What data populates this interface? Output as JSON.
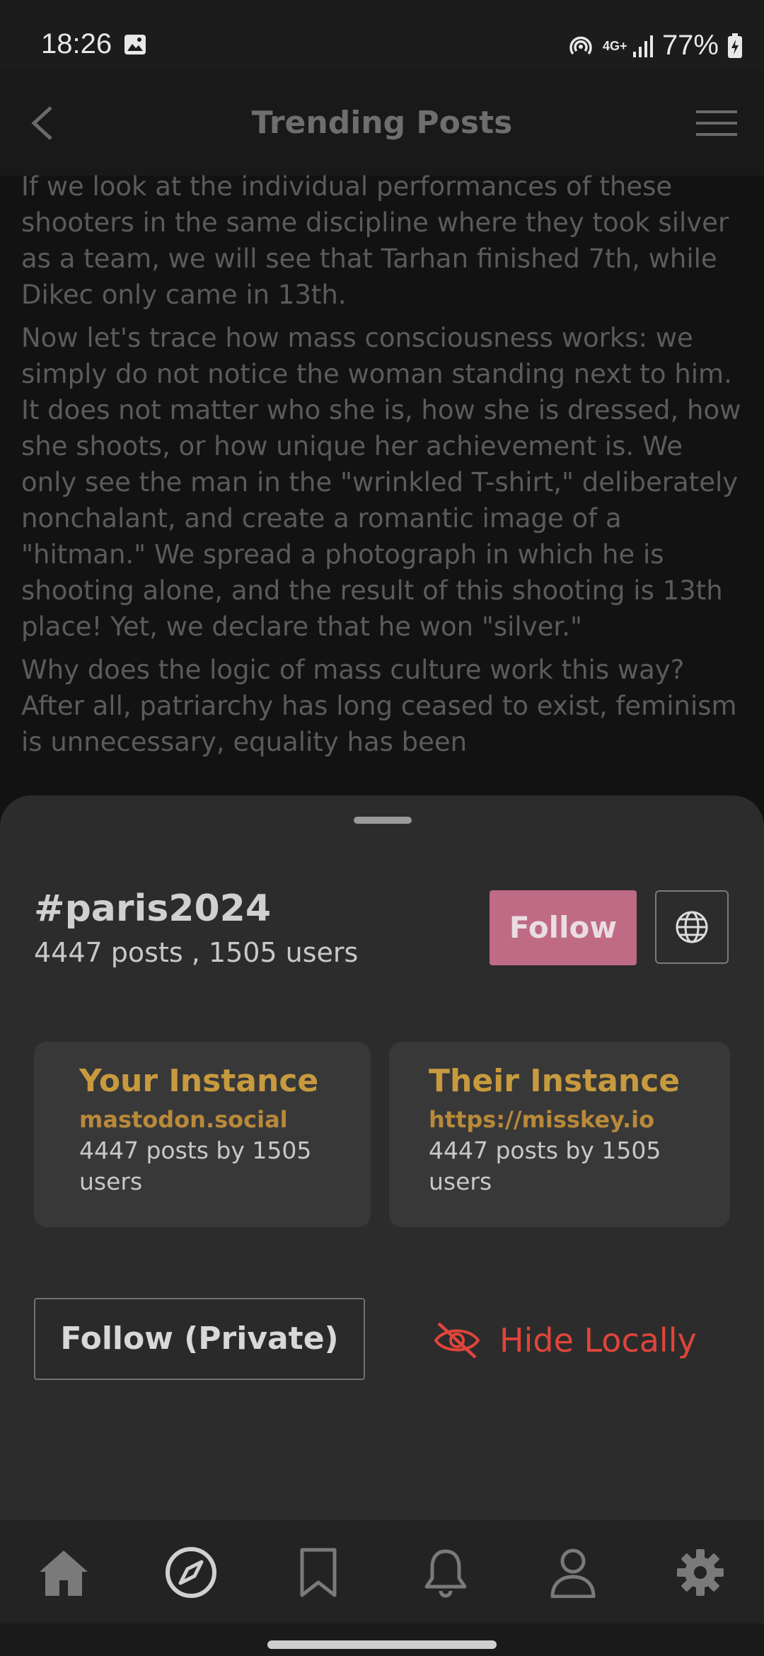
{
  "status": {
    "time": "18:26",
    "network": "4G+",
    "battery": "77%"
  },
  "appbar": {
    "title": "Trending Posts"
  },
  "article": {
    "paragraphs": [
      "If we look at the individual performances of these shooters in the same discipline where they took silver as a team, we will see that Tarhan finished 7th, while Dikec only came in 13th.",
      "Now let's trace how mass consciousness works: we simply do not notice the woman standing next to him. It does not matter who she is, how she is dressed, how she shoots, or how unique her achievement is. We only see the man in the \"wrinkled T-shirt,\" deliberately nonchalant, and create a romantic image of a \"hitman.\" We spread a photograph in which he is shooting alone, and the result of this shooting is 13th place! Yet, we declare that he won \"silver.\"",
      "Why does the logic of mass culture work this way? After all, patriarchy has long ceased to exist, feminism is unnecessary, equality has been"
    ]
  },
  "sheet": {
    "hashtag": "#paris2024",
    "counts": "4447 posts , 1505 users",
    "follow_label": "Follow",
    "your_instance": {
      "title": "Your Instance",
      "host": "mastodon.social",
      "info": "4447 posts by 1505 users"
    },
    "their_instance": {
      "title": "Their Instance",
      "host": "https://misskey.io",
      "info": "4447 posts by 1505 users"
    },
    "follow_private_label": "Follow (Private)",
    "hide_label": "Hide Locally"
  },
  "colors": {
    "accent_follow": "#c06b85",
    "instance_title": "#c89a3e",
    "hide_red": "#e0453a"
  },
  "nav": {
    "items": [
      "home-icon",
      "explore-compass-icon",
      "bookmark-icon",
      "notifications-bell-icon",
      "profile-icon",
      "settings-gear-icon"
    ],
    "active": "explore-compass-icon"
  }
}
